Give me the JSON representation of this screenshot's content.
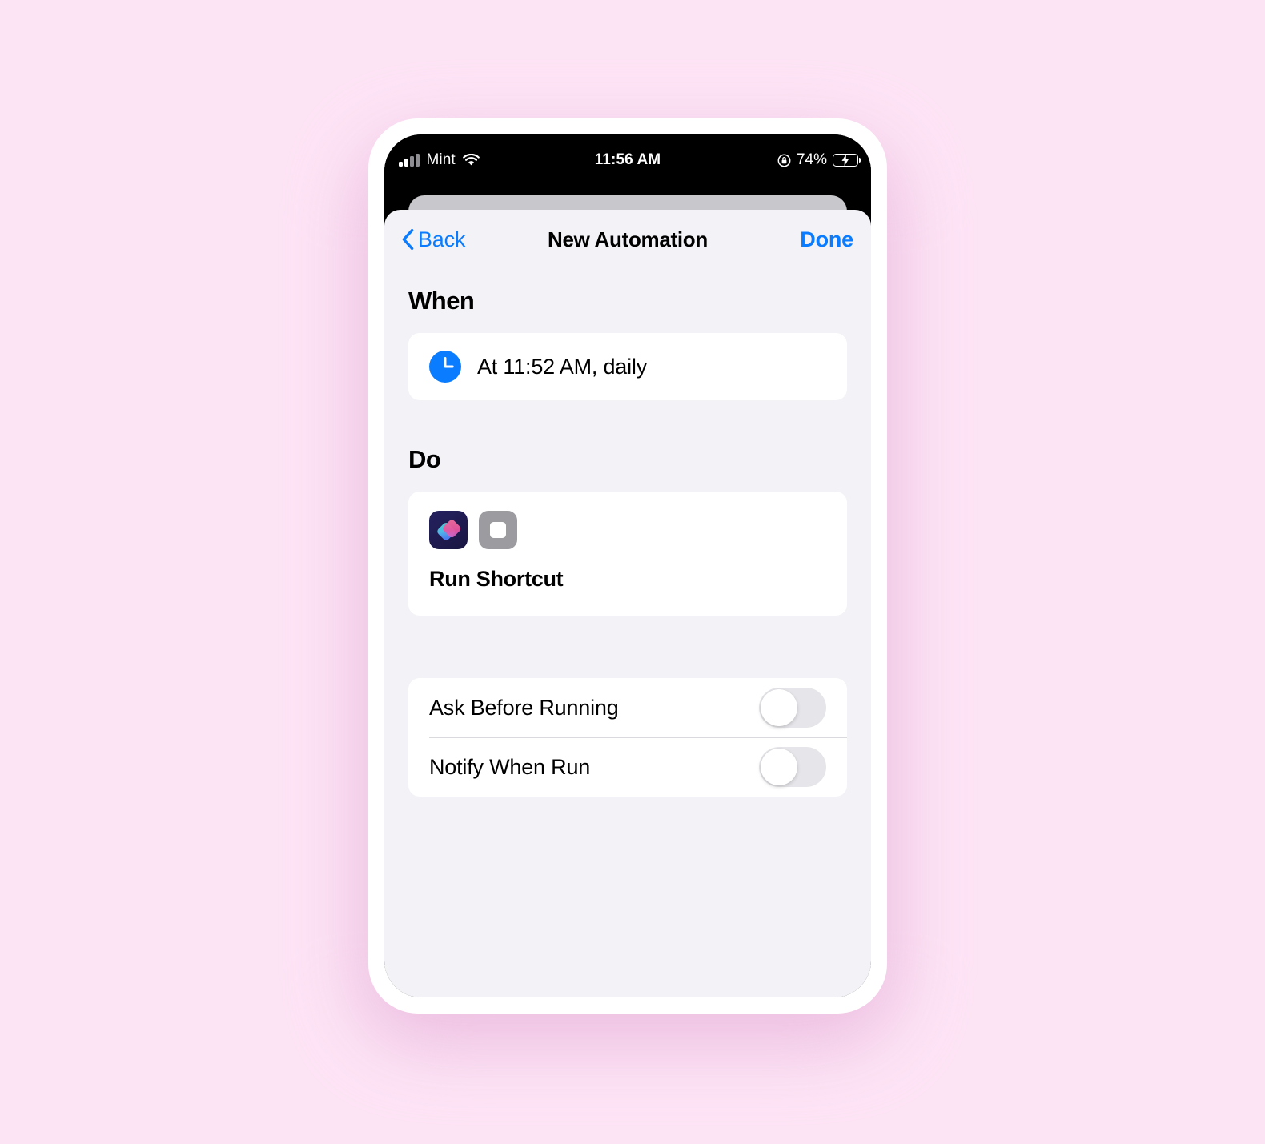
{
  "theme": {
    "page_background": "#FDE4F5",
    "accent_blue": "#0A7CFF",
    "sheet_background": "#F2F2F7",
    "card_background": "#FFFFFF",
    "toggle_off_track": "#E6E6EA",
    "battery_green": "#30D158"
  },
  "status_bar": {
    "carrier": "Mint",
    "signal_icon": "cellular-signal-icon",
    "wifi_icon": "wifi-icon",
    "time": "11:56 AM",
    "rotation_lock_icon": "rotation-lock-icon",
    "battery_percent": "74%",
    "battery_icon": "battery-charging-icon"
  },
  "nav": {
    "back_label": "Back",
    "back_icon": "chevron-left-icon",
    "title": "New Automation",
    "done_label": "Done"
  },
  "sections": {
    "when": {
      "heading": "When",
      "trigger": {
        "icon": "clock-icon",
        "text": "At 11:52 AM, daily"
      }
    },
    "do": {
      "heading": "Do",
      "action": {
        "app_icon": "shortcuts-app-icon",
        "secondary_icon": "stop-square-icon",
        "label": "Run Shortcut"
      }
    },
    "options": {
      "rows": [
        {
          "label": "Ask Before Running",
          "enabled": false
        },
        {
          "label": "Notify When Run",
          "enabled": false
        }
      ]
    }
  }
}
